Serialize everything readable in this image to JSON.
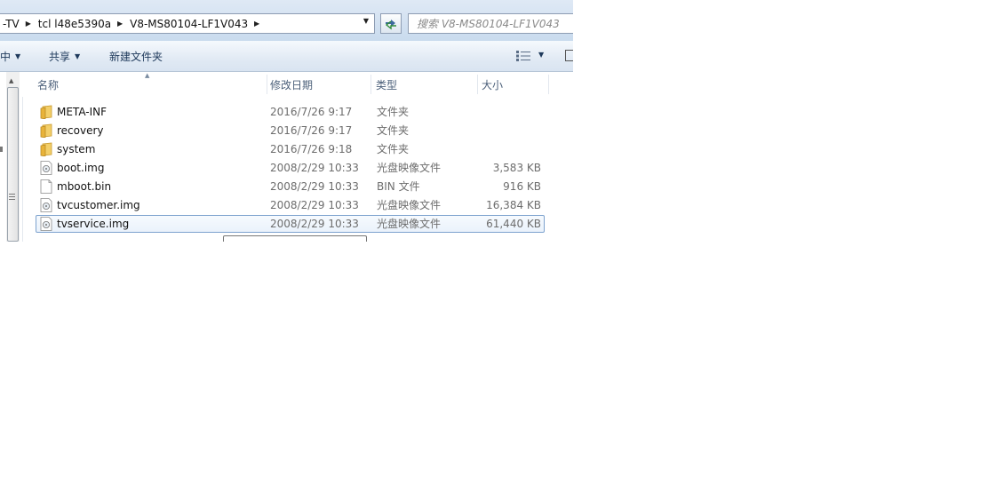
{
  "address_bar": {
    "breadcrumbs": [
      "-TV",
      "tcl l48e5390a",
      "V8-MS80104-LF1V043"
    ],
    "search_placeholder": "搜索 V8-MS80104-LF1V043"
  },
  "toolbar": {
    "include_label": "中",
    "share_label": "共享",
    "new_folder_label": "新建文件夹"
  },
  "columns": {
    "name": "名称",
    "date": "修改日期",
    "type": "类型",
    "size": "大小"
  },
  "files": [
    {
      "name": "META-INF",
      "date": "2016/7/26 9:17",
      "type": "文件夹",
      "size": "",
      "icon": "folder-icon"
    },
    {
      "name": "recovery",
      "date": "2016/7/26 9:17",
      "type": "文件夹",
      "size": "",
      "icon": "folder-icon"
    },
    {
      "name": "system",
      "date": "2016/7/26 9:18",
      "type": "文件夹",
      "size": "",
      "icon": "folder-icon"
    },
    {
      "name": "boot.img",
      "date": "2008/2/29 10:33",
      "type": "光盘映像文件",
      "size": "3,583 KB",
      "icon": "disc-image-icon"
    },
    {
      "name": "mboot.bin",
      "date": "2008/2/29 10:33",
      "type": "BIN 文件",
      "size": "916 KB",
      "icon": "file-icon"
    },
    {
      "name": "tvcustomer.img",
      "date": "2008/2/29 10:33",
      "type": "光盘映像文件",
      "size": "16,384 KB",
      "icon": "disc-image-icon"
    },
    {
      "name": "tvservice.img",
      "date": "2008/2/29 10:33",
      "type": "光盘映像文件",
      "size": "61,440 KB",
      "icon": "disc-image-icon",
      "selected": true
    }
  ],
  "colors": {
    "selection_border": "#7da2ce",
    "header_text": "#4c607a",
    "toolbar_text": "#1e395b",
    "folder": "#e8b33a"
  }
}
